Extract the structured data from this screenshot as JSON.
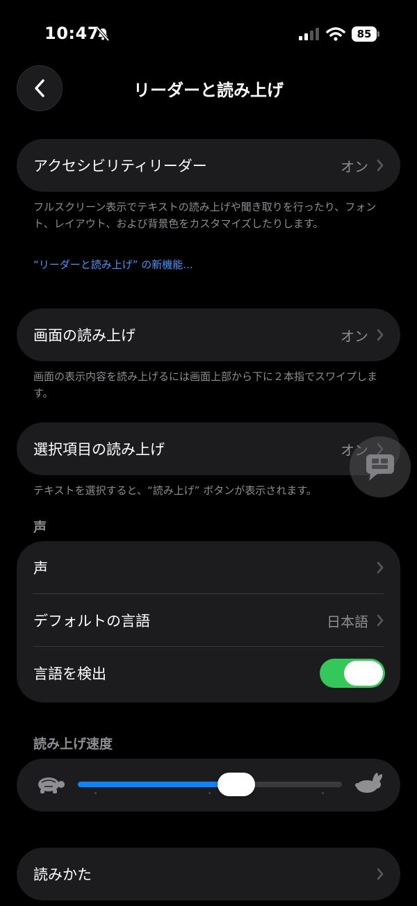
{
  "status_bar": {
    "time": "10:47",
    "battery": "85"
  },
  "nav": {
    "title": "リーダーと読み上げ"
  },
  "accessibility_reader": {
    "label": "アクセシビリティリーダー",
    "value": "オン",
    "footnote": "フルスクリーン表示でテキストの読み上げや聞き取りを行ったり、フォント、レイアウト、および背景色をカスタマイズしたりします。",
    "link": "“リーダーと読み上げ” の新機能..."
  },
  "speak_screen": {
    "label": "画面の読み上げ",
    "value": "オン",
    "footnote": "画面の表示内容を読み上げるには画面上部から下に２本指でスワイプします。"
  },
  "speak_selection": {
    "label": "選択項目の読み上げ",
    "value": "オン",
    "footnote": "テキストを選択すると、“読み上げ” ボタンが表示されます。"
  },
  "voice_section": {
    "header": "声",
    "voice_label": "声",
    "default_language_label": "デフォルトの言語",
    "default_language_value": "日本語",
    "detect_language_label": "言語を検出",
    "detect_language_on": true
  },
  "speaking_rate": {
    "header": "読み上げ速度",
    "value": 0.6
  },
  "pronunciation": {
    "label": "読みかた"
  },
  "colors": {
    "accent": "#0a84ff",
    "toggle_on": "#34c759",
    "link": "#3a9bff"
  }
}
